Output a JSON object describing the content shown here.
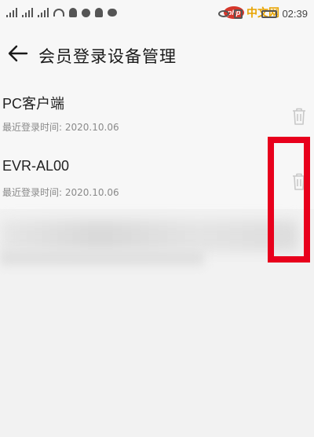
{
  "status_bar": {
    "time": "02:39",
    "watermark_logo": "php",
    "watermark_text": "中文网"
  },
  "header": {
    "title": "会员登录设备管理",
    "back_icon": "arrow-left-icon"
  },
  "devices": [
    {
      "name": "PC客户端",
      "last_login_label": "最近登录时间:",
      "last_login_date": "2020.10.06"
    },
    {
      "name": "EVR-AL00",
      "last_login_label": "最近登录时间:",
      "last_login_date": "2020.10.06"
    }
  ],
  "colors": {
    "highlight": "#e8001c",
    "background": "#f2f2f2"
  }
}
